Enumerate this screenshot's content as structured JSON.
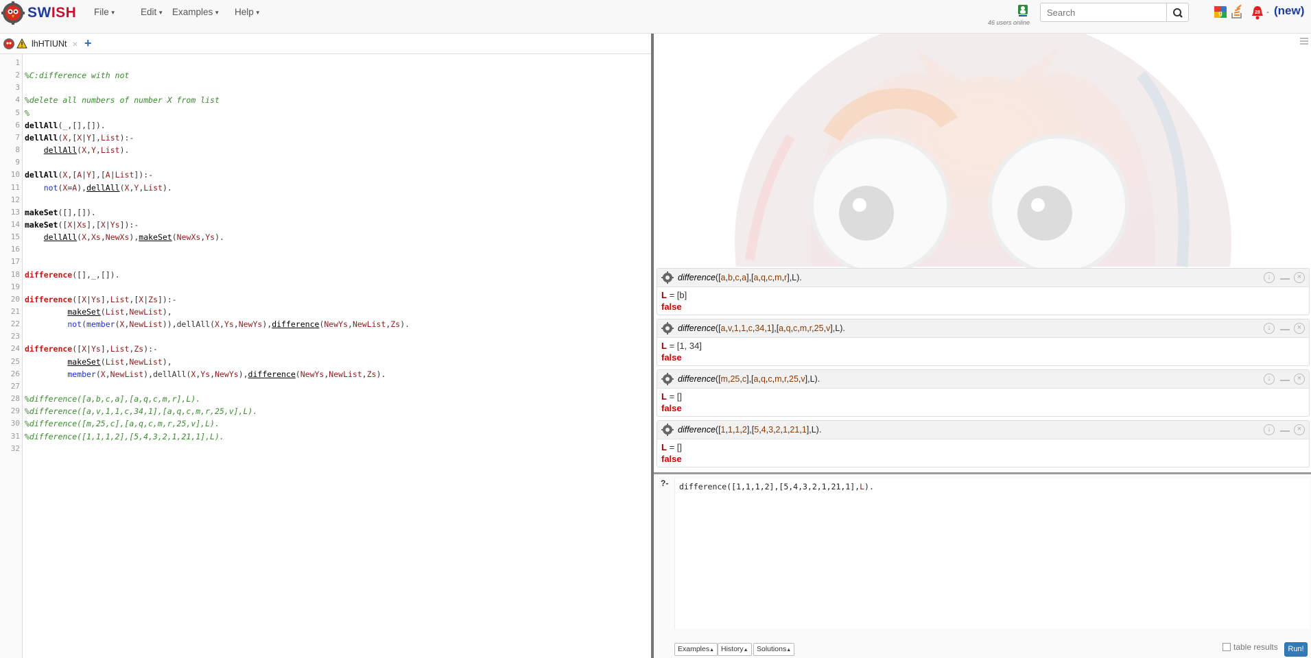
{
  "app": {
    "brand_first": "SW",
    "brand_second": "ISH"
  },
  "menu": [
    {
      "label": "File"
    },
    {
      "label": "Edit"
    },
    {
      "label": "Examples"
    },
    {
      "label": "Help"
    }
  ],
  "header": {
    "users_online": "46 users online",
    "search_placeholder": "Search"
  },
  "header_icons": [
    "google-plus-icon",
    "stackoverflow-icon",
    "notifications-icon",
    "new-icon"
  ],
  "notification_count": "28",
  "new_label": "(new)",
  "editor": {
    "tab_title": "lhHTIUNt",
    "tab_close": "×",
    "new_tab": "+",
    "lines": [
      "",
      "%C:difference with not",
      "",
      "%delete all numbers of number X from list",
      "%",
      "dellAll(_,[],[]).",
      "dellAll(X,[X|Y],List):-",
      "    dellAll(X,Y,List).",
      "",
      "dellAll(X,[A|Y],[A|List]):-",
      "    not(X=A),dellAll(X,Y,List).",
      "",
      "makeSet([],[]).",
      "makeSet([X|Xs],[X|Ys]):-",
      "    dellAll(X,Xs,NewXs),makeSet(NewXs,Ys).",
      "",
      "",
      "difference([],_,[]).",
      "",
      "difference([X|Ys],List,[X|Zs]):-",
      "         makeSet(List,NewList),",
      "         not(member(X,NewList)),dellAll(X,Ys,NewYs),difference(NewYs,NewList,Zs).",
      "",
      "difference([X|Ys],List,Zs):-",
      "         makeSet(List,NewList),",
      "         member(X,NewList),dellAll(X,Ys,NewYs),difference(NewYs,NewList,Zs).",
      "",
      "%difference([a,b,c,a],[a,q,c,m,r],L).",
      "%difference([a,v,1,1,c,34,1],[a,q,c,m,r,25,v],L).",
      "%difference([m,25,c],[a,q,c,m,r,25,v],L).",
      "%difference([1,1,1,2],[5,4,3,2,1,21,1],L).",
      ""
    ]
  },
  "answers": [
    {
      "pred": "difference",
      "args": "([a,b,c,a],[a,q,c,m,r],L).",
      "var": "L",
      "value": " = [b]",
      "status": "false"
    },
    {
      "pred": "difference",
      "args": "([a,v,1,1,c,34,1],[a,q,c,m,r,25,v],L).",
      "var": "L",
      "value": " = [1, 34]",
      "status": "false"
    },
    {
      "pred": "difference",
      "args": "([m,25,c],[a,q,c,m,r,25,v],L).",
      "var": "L",
      "value": " = []",
      "status": "false"
    },
    {
      "pred": "difference",
      "args": "([1,1,1,2],[5,4,3,2,1,21,1],L).",
      "var": "L",
      "value": " = []",
      "status": "false"
    }
  ],
  "query": {
    "prompt": "?-",
    "text": "difference([1,1,1,2],[5,4,3,2,1,21,1],L).",
    "examples_label": "Examples",
    "history_label": "History",
    "solutions_label": "Solutions",
    "table_results_label": "table results",
    "run_label": "Run!"
  }
}
